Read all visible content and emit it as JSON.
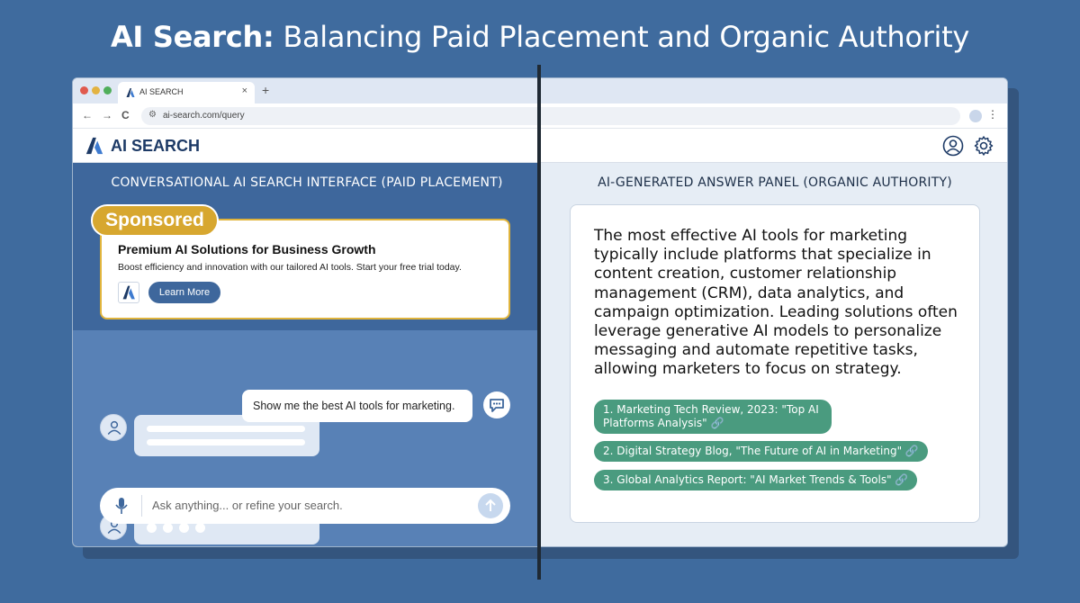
{
  "header": {
    "title_bold": "AI Search:",
    "title_rest": " Balancing Paid Placement and Organic Authority"
  },
  "browser": {
    "tab_title": "AI SEARCH",
    "tab_close": "×",
    "new_tab": "+",
    "url": "ai-search.com/query",
    "back": "←",
    "forward": "→",
    "reload": "C",
    "menu": "⋮"
  },
  "app": {
    "name": "AI SEARCH"
  },
  "left_panel": {
    "heading": "CONVERSATIONAL AI SEARCH INTERFACE (PAID PLACEMENT)",
    "sponsored_label": "Sponsored",
    "ad_title": "Premium AI Solutions for Business Growth",
    "ad_description": "Boost efficiency and innovation with our tailored AI tools. Start your free trial today.",
    "ad_button": "Learn More",
    "user_message": "Show me the best AI tools for marketing.",
    "search_placeholder": "Ask anything... or refine your search."
  },
  "right_panel": {
    "heading": "AI-GENERATED ANSWER PANEL (ORGANIC AUTHORITY)",
    "answer": "The most effective AI tools for marketing typically include platforms that specialize in content creation, customer relationship management (CRM), data analytics, and\ncampaign optimization. Leading solutions often leverage generative AI models to personalize messaging and automate repetitive tasks, allowing marketers to focus on strategy.",
    "citations": [
      "1. Marketing Tech Review, 2023: \"Top AI\nPlatforms Analysis\" 🔗",
      "2. Digital Strategy Blog, \"The Future of AI in Marketing\" 🔗",
      "3. Global Analytics Report: \"AI Market Trends & Tools\" 🔗"
    ]
  },
  "colors": {
    "background": "#3f6b9e",
    "sponsored": "#d7a72f",
    "citation": "#4a9b7f",
    "brand": "#1d3a66"
  }
}
